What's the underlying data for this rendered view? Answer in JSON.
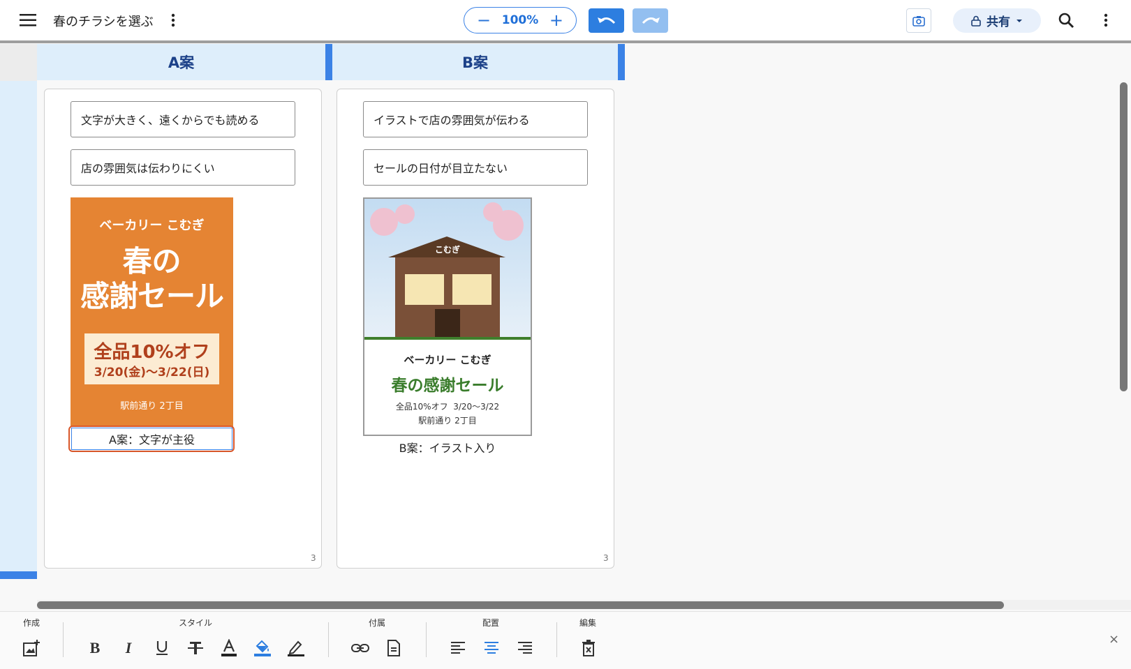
{
  "header": {
    "title": "春のチラシを選ぶ",
    "zoom_minus": "−",
    "zoom_level": "100%",
    "zoom_plus": "+",
    "share_label": "共有"
  },
  "columns": [
    {
      "header": "A案",
      "notes": [
        "文字が大きく、遠くからでも読める",
        "店の雰囲気は伝わりにくい"
      ],
      "poster": {
        "shop": "ベーカリー こむぎ",
        "title_line1": "春の",
        "title_line2": "感謝セール",
        "offer": "全品10%オフ",
        "dates": "3/20(金)〜3/22(日)",
        "address": "駅前通り 2丁目"
      },
      "caption": "A案：文字が主役",
      "page_number": "3"
    },
    {
      "header": "B案",
      "notes": [
        "イラストで店の雰囲気が伝わる",
        "セールの日付が目立たない"
      ],
      "poster": {
        "roof_sign": "こむぎ",
        "shop": "ベーカリー こむぎ",
        "title": "春の感謝セール",
        "offer_line": "全品10%オフ  3/20〜3/22",
        "address": "駅前通り 2丁目"
      },
      "caption": "B案：イラスト入り",
      "page_number": "3"
    }
  ],
  "toolbar": {
    "groups": {
      "create": "作成",
      "style": "スタイル",
      "attach": "付属",
      "align": "配置",
      "edit": "編集"
    },
    "close": "×"
  },
  "colors": {
    "accent": "#2d7ee0",
    "poster_a_bg": "#e58433",
    "poster_b_title": "#3a7d2c",
    "selection": "#d9572a"
  },
  "icons": [
    "menu-icon",
    "more-vert-icon",
    "undo-icon",
    "redo-icon",
    "camera-icon",
    "lock-icon",
    "dropdown-icon",
    "search-icon",
    "add-image-icon",
    "bold-icon",
    "italic-icon",
    "underline-icon",
    "strikethrough-icon",
    "text-color-icon",
    "fill-color-icon",
    "highlight-pen-icon",
    "link-icon",
    "document-icon",
    "align-left-icon",
    "align-center-icon",
    "align-right-icon",
    "delete-icon",
    "close-icon"
  ]
}
